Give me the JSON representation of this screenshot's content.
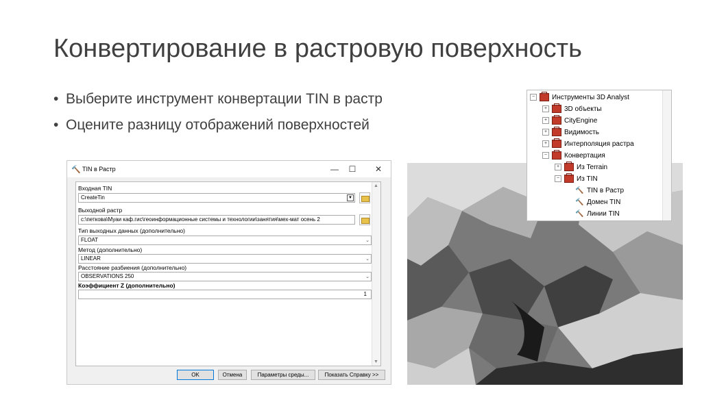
{
  "slide": {
    "title": "Конвертирование в растровую поверхность",
    "bullets": [
      "Выберите инструмент конвертации TIN в растр",
      "Оцените разницу отображений поверхностей"
    ]
  },
  "dialog": {
    "title": "TIN в Растр",
    "fields": {
      "input_tin_label": "Входная TIN",
      "input_tin_value": "CreateTin",
      "output_raster_label": "Выходной растр",
      "output_raster_value": "c:\\петкова\\Муаи каф.гис\\геоинформационные системы и технологии\\занятия\\мех-мат осень 2",
      "output_type_label": "Тип выходных данных (дополнительно)",
      "output_type_value": "FLOAT",
      "method_label": "Метод (дополнительно)",
      "method_value": "LINEAR",
      "sampling_label": "Расстояние разбиения (дополнительно)",
      "sampling_value": "OBSERVATIONS 250",
      "zfactor_label": "Коэффициент Z (дополнительно)",
      "zfactor_value": "1"
    },
    "buttons": {
      "ok": "OK",
      "cancel": "Отмена",
      "env": "Параметры среды...",
      "help": "Показать Справку >>"
    }
  },
  "toolbox": {
    "items": [
      {
        "label": "Инструменты 3D Analyst",
        "expander": "⊟"
      },
      {
        "label": "3D объекты",
        "expander": "⊞"
      },
      {
        "label": "CityEngine",
        "expander": "⊞"
      },
      {
        "label": "Видимость",
        "expander": "⊞"
      },
      {
        "label": "Интерполяция растра",
        "expander": "⊞"
      },
      {
        "label": "Конвертация",
        "expander": "⊟"
      },
      {
        "label": "Из Terrain",
        "expander": "⊞"
      },
      {
        "label": "Из TIN",
        "expander": "⊟"
      },
      {
        "label": "TIN в Растр"
      },
      {
        "label": "Домен TIN"
      },
      {
        "label": "Линии TIN"
      }
    ]
  },
  "colors": {
    "title_text": "#404040",
    "toolbox_icon": "#c23a2a",
    "ok_border": "#0078d7"
  }
}
